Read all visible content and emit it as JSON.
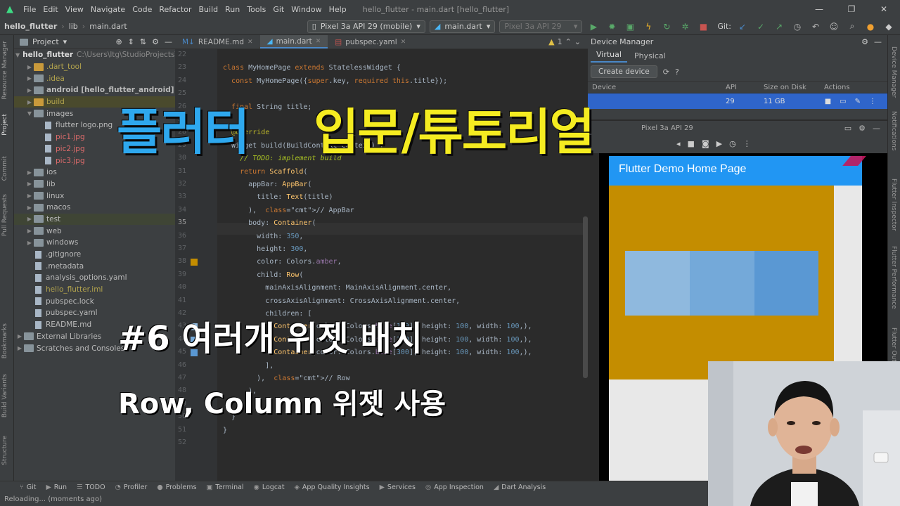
{
  "menu": {
    "items": [
      "File",
      "Edit",
      "View",
      "Navigate",
      "Code",
      "Refactor",
      "Build",
      "Run",
      "Tools",
      "Git",
      "Window",
      "Help"
    ],
    "window_title": "hello_flutter - main.dart [hello_flutter]"
  },
  "toolbar": {
    "crumb_project": "hello_flutter",
    "crumb_lib": "lib",
    "crumb_file": "main.dart",
    "device_combo": "Pixel 3a API 29 (mobile)",
    "config_combo": "main.dart",
    "avd_combo": "Pixel 3a API 29",
    "git_label": "Git:"
  },
  "left_strip": [
    "Resource Manager",
    "Project",
    "Commit",
    "Pull Requests",
    "Bookmarks",
    "Build Variants",
    "Structure"
  ],
  "right_strip": [
    "Device Manager",
    "Notifications",
    "Flutter Inspector",
    "Flutter Performance",
    "Flutter Outline"
  ],
  "project": {
    "header": "Project",
    "root_name": "hello_flutter",
    "root_path": "C:\\Users\\ltg\\StudioProjects\\",
    "items": [
      {
        "label": ".dart_tool",
        "kind": "folder-excluded",
        "color": "olive",
        "indent": 1
      },
      {
        "label": ".idea",
        "kind": "folder",
        "color": "olive",
        "indent": 1
      },
      {
        "label": "android [hello_flutter_android]",
        "kind": "folder",
        "color": "bold",
        "indent": 1
      },
      {
        "label": "build",
        "kind": "folder-excluded",
        "color": "olive",
        "indent": 1
      },
      {
        "label": "images",
        "kind": "folder",
        "color": "normal",
        "indent": 1,
        "open": true
      },
      {
        "label": "flutter logo.png",
        "kind": "file",
        "color": "normal",
        "indent": 2
      },
      {
        "label": "pic1.jpg",
        "kind": "file",
        "color": "red",
        "indent": 2
      },
      {
        "label": "pic2.jpg",
        "kind": "file",
        "color": "red",
        "indent": 2
      },
      {
        "label": "pic3.jpg",
        "kind": "file",
        "color": "red",
        "indent": 2
      },
      {
        "label": "ios",
        "kind": "folder",
        "color": "normal",
        "indent": 1
      },
      {
        "label": "lib",
        "kind": "folder",
        "color": "normal",
        "indent": 1
      },
      {
        "label": "linux",
        "kind": "folder",
        "color": "normal",
        "indent": 1
      },
      {
        "label": "macos",
        "kind": "folder",
        "color": "normal",
        "indent": 1
      },
      {
        "label": "test",
        "kind": "folder",
        "color": "normal",
        "indent": 1
      },
      {
        "label": "web",
        "kind": "folder",
        "color": "normal",
        "indent": 1
      },
      {
        "label": "windows",
        "kind": "folder",
        "color": "normal",
        "indent": 1
      },
      {
        "label": ".gitignore",
        "kind": "file",
        "color": "normal",
        "indent": 1
      },
      {
        "label": ".metadata",
        "kind": "file",
        "color": "normal",
        "indent": 1
      },
      {
        "label": "analysis_options.yaml",
        "kind": "file",
        "color": "normal",
        "indent": 1
      },
      {
        "label": "hello_flutter.iml",
        "kind": "file",
        "color": "olive",
        "indent": 1
      },
      {
        "label": "pubspec.lock",
        "kind": "file",
        "color": "normal",
        "indent": 1
      },
      {
        "label": "pubspec.yaml",
        "kind": "file",
        "color": "normal",
        "indent": 1
      },
      {
        "label": "README.md",
        "kind": "file",
        "color": "normal",
        "indent": 1
      },
      {
        "label": "External Libraries",
        "kind": "folder",
        "color": "normal",
        "indent": 0
      },
      {
        "label": "Scratches and Consoles",
        "kind": "folder",
        "color": "normal",
        "indent": 0
      }
    ]
  },
  "editor": {
    "tabs": [
      {
        "label": "README.md",
        "active": false
      },
      {
        "label": "main.dart",
        "active": true
      },
      {
        "label": "pubspec.yaml",
        "active": false
      }
    ],
    "warning_count": "1",
    "lines": [
      {
        "n": "22",
        "t": ""
      },
      {
        "n": "23",
        "t": "class MyHomePage extends StatelessWidget {"
      },
      {
        "n": "24",
        "t": "  const MyHomePage({super.key, required this.title});"
      },
      {
        "n": "25",
        "t": ""
      },
      {
        "n": "26",
        "t": "  final String title;"
      },
      {
        "n": "27",
        "t": ""
      },
      {
        "n": "28",
        "t": "  @override"
      },
      {
        "n": "29",
        "t": "  Widget build(BuildContext context) {"
      },
      {
        "n": "30",
        "t": "    // TODO: implement build"
      },
      {
        "n": "31",
        "t": "    return Scaffold("
      },
      {
        "n": "32",
        "t": "      appBar: AppBar("
      },
      {
        "n": "33",
        "t": "        title: Text(title)"
      },
      {
        "n": "34",
        "t": "      ),  // AppBar"
      },
      {
        "n": "35",
        "t": "      body: Container("
      },
      {
        "n": "36",
        "t": "        width: 350,"
      },
      {
        "n": "37",
        "t": "        height: 300,"
      },
      {
        "n": "38",
        "t": "        color: Colors.amber,"
      },
      {
        "n": "39",
        "t": "        child: Row("
      },
      {
        "n": "40",
        "t": "          mainAxisAlignment: MainAxisAlignment.center,"
      },
      {
        "n": "41",
        "t": "          crossAxisAlignment: CrossAxisAlignment.center,"
      },
      {
        "n": "42",
        "t": "          children: ["
      },
      {
        "n": "43",
        "t": "            Container(color: Colors.blue[100], height: 100, width: 100,),"
      },
      {
        "n": "44",
        "t": "            Container(color: Colors.blue[200], height: 100, width: 100,),"
      },
      {
        "n": "45",
        "t": "            Container(color: Colors.blue[300], height: 100, width: 100,),"
      },
      {
        "n": "46",
        "t": "          ],"
      },
      {
        "n": "47",
        "t": "        ),  // Row"
      },
      {
        "n": "48",
        "t": "      ),"
      },
      {
        "n": "49",
        "t": "    );"
      },
      {
        "n": "50",
        "t": "  }"
      },
      {
        "n": "51",
        "t": "}"
      },
      {
        "n": "52",
        "t": ""
      }
    ],
    "current_line": "35"
  },
  "device_manager": {
    "title": "Device Manager",
    "tabs": [
      "Virtual",
      "Physical"
    ],
    "create_button": "Create device",
    "columns": [
      "Device",
      "API",
      "Size on Disk",
      "Actions"
    ],
    "row": {
      "api": "29",
      "size": "11 GB"
    },
    "emu_tab": "Pixel 3a API 29"
  },
  "emulator": {
    "app_title": "Flutter Demo Home Page",
    "colors": {
      "appbar": "#2196f3",
      "amber": "#c48d00",
      "blue100": "#8fb9de",
      "blue200": "#74a9d9",
      "blue300": "#5a98d3"
    }
  },
  "tool_windows": [
    "Git",
    "Run",
    "TODO",
    "Profiler",
    "Problems",
    "Terminal",
    "Logcat",
    "App Quality Insights",
    "Services",
    "App Inspection",
    "Dart Analysis"
  ],
  "status": "Reloading... (moments ago)",
  "overlay": {
    "title_blue": "플러터",
    "title_yellow": "입문/튜토리얼",
    "episode": "#6 여러개 위젯 배치",
    "subtitle": "Row, Column 위젯 사용"
  }
}
